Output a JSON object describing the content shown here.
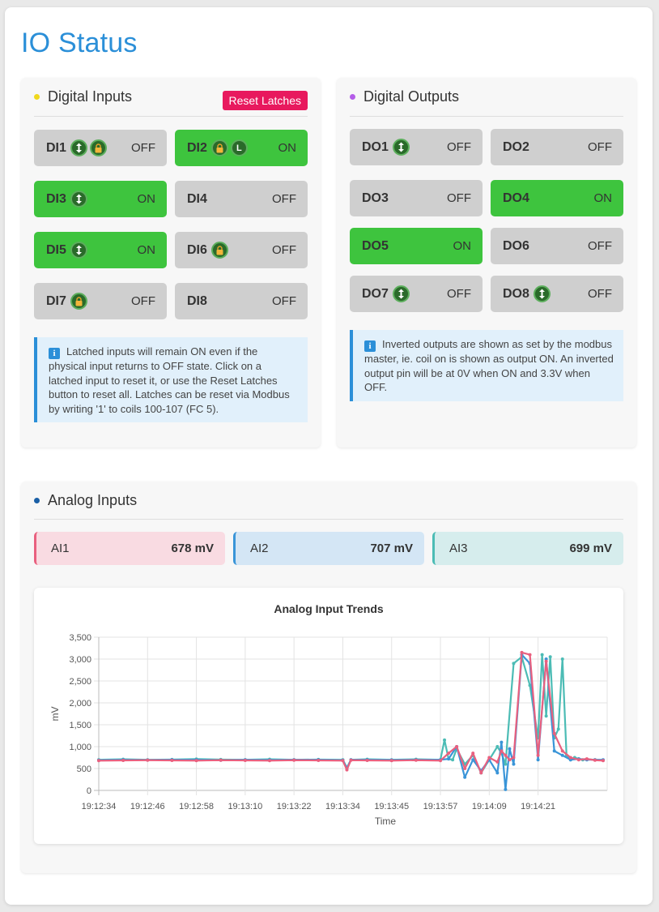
{
  "page": {
    "title": "IO Status"
  },
  "digital_inputs": {
    "title": "Digital Inputs",
    "dot_color": "#f0d81c",
    "reset_label": "Reset Latches",
    "items": [
      {
        "name": "DI1",
        "state": "OFF",
        "on": false,
        "icons": [
          "toggle-icon",
          "lock-icon"
        ]
      },
      {
        "name": "DI2",
        "state": "ON",
        "on": true,
        "icons": [
          "lock-icon",
          "latched-L-icon"
        ]
      },
      {
        "name": "DI3",
        "state": "ON",
        "on": true,
        "icons": [
          "toggle-icon"
        ]
      },
      {
        "name": "DI4",
        "state": "OFF",
        "on": false,
        "icons": []
      },
      {
        "name": "DI5",
        "state": "ON",
        "on": true,
        "icons": [
          "toggle-icon"
        ]
      },
      {
        "name": "DI6",
        "state": "OFF",
        "on": false,
        "icons": [
          "lock-icon"
        ]
      },
      {
        "name": "DI7",
        "state": "OFF",
        "on": false,
        "icons": [
          "lock-icon"
        ]
      },
      {
        "name": "DI8",
        "state": "OFF",
        "on": false,
        "icons": []
      }
    ],
    "latched_letter": "L",
    "info": "Latched inputs will remain ON even if the physical input returns to OFF state. Click on a latched input to reset it, or use the Reset Latches button to reset all. Latches can be reset via Modbus by writing '1' to coils 100-107 (FC 5)."
  },
  "digital_outputs": {
    "title": "Digital Outputs",
    "dot_color": "#b45de8",
    "items": [
      {
        "name": "DO1",
        "state": "OFF",
        "on": false,
        "icons": [
          "toggle-icon"
        ]
      },
      {
        "name": "DO2",
        "state": "OFF",
        "on": false,
        "icons": []
      },
      {
        "name": "DO3",
        "state": "OFF",
        "on": false,
        "icons": []
      },
      {
        "name": "DO4",
        "state": "ON",
        "on": true,
        "icons": []
      },
      {
        "name": "DO5",
        "state": "ON",
        "on": true,
        "icons": []
      },
      {
        "name": "DO6",
        "state": "OFF",
        "on": false,
        "icons": []
      },
      {
        "name": "DO7",
        "state": "OFF",
        "on": false,
        "icons": [
          "toggle-icon"
        ]
      },
      {
        "name": "DO8",
        "state": "OFF",
        "on": false,
        "icons": [
          "toggle-icon"
        ]
      }
    ],
    "info": "Inverted outputs are shown as set by the modbus master, ie. coil on is shown as output ON. An inverted output pin will be at 0V when ON and 3.3V when OFF."
  },
  "analog_inputs": {
    "title": "Analog Inputs",
    "dot_color": "#1a5fa6",
    "items": [
      {
        "name": "AI1",
        "value": "678 mV",
        "bg": "#f9dbe2",
        "accent": "#e9607f"
      },
      {
        "name": "AI2",
        "value": "707 mV",
        "bg": "#d4e6f5",
        "accent": "#3a95d8"
      },
      {
        "name": "AI3",
        "value": "699 mV",
        "bg": "#d6eded",
        "accent": "#4cbcb5"
      }
    ]
  },
  "colors": {
    "title": "#2b8fd8",
    "on": "#3ec43e",
    "off": "#cfcfcf",
    "reset": "#e8195e"
  },
  "chart_data": {
    "type": "line",
    "title": "Analog Input Trends",
    "xlabel": "Time",
    "ylabel": "mV",
    "ylim": [
      0,
      3500
    ],
    "yticks": [
      "0",
      "500",
      "1,000",
      "1,500",
      "2,000",
      "2,500",
      "3,000",
      "3,500"
    ],
    "xticks": [
      "19:12:34",
      "19:12:46",
      "19:12:58",
      "19:13:10",
      "19:13:22",
      "19:13:34",
      "19:13:45",
      "19:13:57",
      "19:14:09",
      "19:14:21"
    ],
    "grid": true,
    "series": [
      {
        "color": "#4cbcb5",
        "seconds": [
          0,
          6,
          12,
          18,
          24,
          30,
          36,
          42,
          48,
          54,
          60,
          61,
          62,
          66,
          72,
          78,
          84,
          85,
          86,
          87,
          88,
          90,
          92,
          94,
          96,
          98,
          99,
          100,
          102,
          104,
          106,
          108,
          109,
          110,
          111,
          112,
          113,
          114,
          115,
          116,
          117,
          118,
          119,
          120,
          122,
          124
        ],
        "values": [
          700,
          710,
          700,
          705,
          715,
          705,
          700,
          710,
          700,
          705,
          700,
          520,
          700,
          710,
          700,
          710,
          700,
          1150,
          720,
          700,
          950,
          600,
          800,
          400,
          700,
          1000,
          850,
          600,
          2900,
          3050,
          2400,
          1200,
          3100,
          1700,
          3050,
          1200,
          1400,
          3000,
          800,
          700,
          750,
          720,
          700,
          710,
          700,
          690
        ]
      },
      {
        "color": "#3a95d8",
        "seconds": [
          0,
          6,
          12,
          18,
          24,
          30,
          36,
          42,
          48,
          54,
          60,
          61,
          62,
          66,
          72,
          78,
          84,
          86,
          88,
          90,
          92,
          94,
          96,
          98,
          99,
          100,
          101,
          102,
          104,
          106,
          108,
          110,
          112,
          114,
          116,
          118,
          120,
          122,
          124
        ],
        "values": [
          690,
          700,
          695,
          700,
          700,
          690,
          700,
          695,
          700,
          700,
          690,
          500,
          700,
          700,
          695,
          700,
          700,
          720,
          1000,
          300,
          700,
          450,
          700,
          400,
          1100,
          20,
          950,
          600,
          3100,
          2900,
          700,
          3000,
          900,
          800,
          700,
          720,
          700,
          700,
          700
        ]
      },
      {
        "color": "#e9607f",
        "seconds": [
          0,
          6,
          12,
          18,
          24,
          30,
          36,
          42,
          48,
          54,
          60,
          61,
          62,
          66,
          72,
          78,
          84,
          86,
          88,
          90,
          92,
          94,
          96,
          98,
          99,
          100,
          101,
          102,
          104,
          106,
          108,
          110,
          112,
          114,
          116,
          118,
          120,
          122,
          124
        ],
        "values": [
          680,
          685,
          690,
          685,
          680,
          690,
          685,
          680,
          690,
          685,
          680,
          470,
          690,
          685,
          680,
          690,
          680,
          850,
          1000,
          500,
          850,
          400,
          750,
          650,
          900,
          800,
          700,
          750,
          3150,
          3100,
          800,
          2950,
          1300,
          900,
          750,
          700,
          720,
          690,
          680
        ]
      }
    ]
  }
}
